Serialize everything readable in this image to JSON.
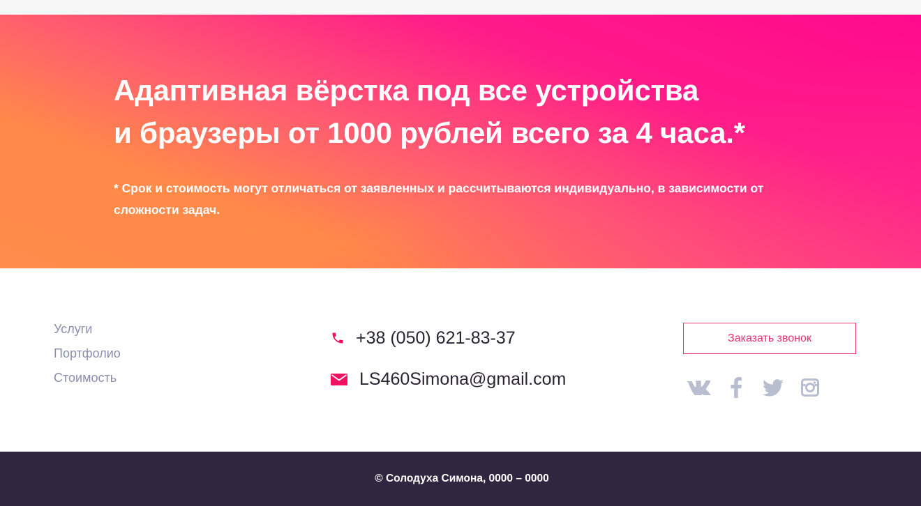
{
  "hero": {
    "title_line1": "Адаптивная вёрстка под все устройства",
    "title_line2": "и браузеры от 1000 рублей всего за 4 часа.*",
    "note": "* Срок и стоимость могут отличаться от заявленных и рассчитываются индивидуально, в зависимости от сложности задач."
  },
  "nav": {
    "items": [
      {
        "label": "Услуги"
      },
      {
        "label": "Портфолио"
      },
      {
        "label": "Стоимость"
      }
    ]
  },
  "contacts": {
    "phone": "+38 (050) 621-83-37",
    "email": "LS460Simona@gmail.com",
    "phone_icon": "phone-icon",
    "email_icon": "envelope-icon"
  },
  "cta": {
    "label": "Заказать звонок"
  },
  "socials": [
    "vk-icon",
    "facebook-icon",
    "twitter-icon",
    "instagram-icon"
  ],
  "footer": {
    "copyright": "© Солодуха Симона, 0000 – 0000"
  },
  "colors": {
    "accent": "#ea2f6f",
    "icon_pink": "#f0125f",
    "social_gray": "#b9bdd0",
    "nav_text": "#8a8fae",
    "footer_bg": "#302640",
    "hero_gradient_start": "#ff0a8c",
    "hero_gradient_end": "#ff8a48"
  }
}
